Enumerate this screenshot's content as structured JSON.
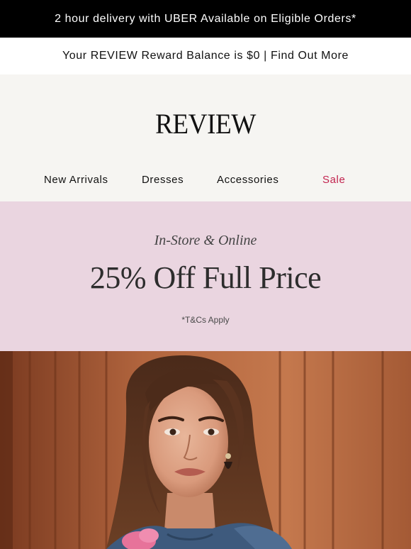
{
  "announcement": {
    "text": "2 hour delivery with UBER Available on Eligible Orders*"
  },
  "reward": {
    "text": "Your REVIEW Reward Balance is $0 | Find Out More"
  },
  "header": {
    "logo": "REVIEW",
    "nav": [
      {
        "label": "New Arrivals"
      },
      {
        "label": "Dresses"
      },
      {
        "label": "Accessories"
      },
      {
        "label": "Sale"
      }
    ]
  },
  "promo": {
    "subtitle": "In-Store & Online",
    "title": "25% Off Full Price",
    "terms": "*T&Cs Apply"
  },
  "colors": {
    "topbar_bg": "#000000",
    "header_bg": "#f6f5f2",
    "promo_bg": "#ead5e0",
    "sale_accent": "#c2244f"
  },
  "hero": {
    "icon": "model-photo-image"
  }
}
